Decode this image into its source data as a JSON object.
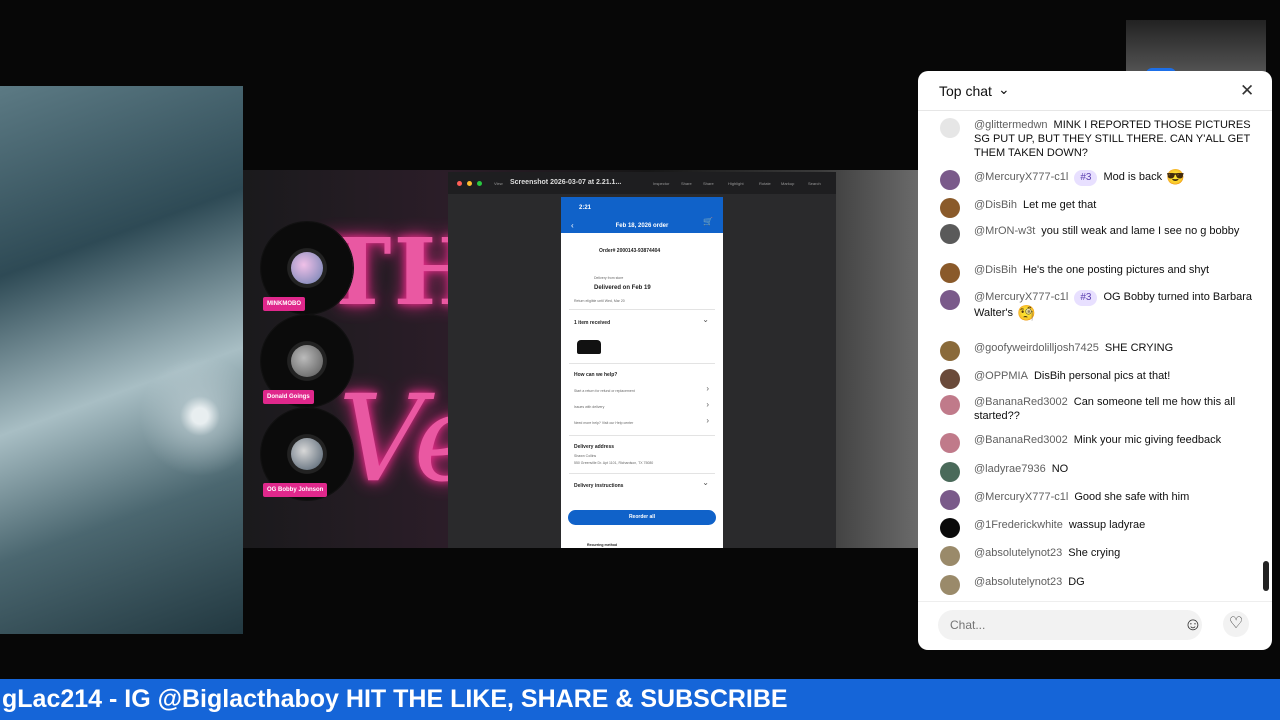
{
  "share": {
    "window_title": "Screenshot 2026-03-07 at 2.21.1...",
    "toolbar": [
      "View",
      "Inspector",
      "Share",
      "Share",
      "Highlight",
      "Rotate",
      "Markup",
      "Search"
    ]
  },
  "discs": [
    {
      "label": "MINKMOBO"
    },
    {
      "label": "Donald Goings"
    },
    {
      "label": "OG Bobby Johnson"
    }
  ],
  "phone": {
    "time": "2:21",
    "date_title": "Feb 18, 2026 order",
    "order_number": "Order# 2000143-93874404",
    "delivery_from": "Delivery from store",
    "delivered": "Delivered on Feb 19",
    "return_note": "Return eligible until Wed, Mar 20",
    "items_received": "1 item received",
    "help_title": "How can we help?",
    "help_items": [
      "Start a return for refund or replacement",
      "Issues with delivery",
      "Need more help? Visit our Help center"
    ],
    "address_title": "Delivery address",
    "address_name": "Shawn Collins",
    "address_line": "550 Greenville Dr. Apt 1101, Richardson, TX 75080",
    "instructions": "Delivery instructions",
    "reorder": "Reorder all",
    "footer": "Recurring method"
  },
  "chat": {
    "mode": "Top chat",
    "input_placeholder": "Chat...",
    "messages": [
      {
        "author": "@glittermedwn",
        "text": "MINK I REPORTED THOSE PICTURES SG PUT UP, BUT THEY STILL THERE. CAN Y'ALL GET THEM TAKEN DOWN?",
        "badge": "",
        "emoji": "",
        "avatar_color": "#e6e6e6"
      },
      {
        "author": "@MercuryX777-c1l",
        "text": "Mod is back",
        "badge": "#3",
        "emoji": "😎",
        "avatar_color": "#7a5a8a"
      },
      {
        "author": "@DisBih",
        "text": "Let me get that",
        "badge": "",
        "emoji": "",
        "avatar_color": "#8a5a2a"
      },
      {
        "author": "@MrON-w3t",
        "text": "you still weak and lame I see no g bobby",
        "badge": "",
        "emoji": "",
        "avatar_color": "#5a5a5a"
      },
      {
        "author": "@DisBih",
        "text": "He's the one posting pictures and shyt",
        "badge": "",
        "emoji": "",
        "avatar_color": "#8a5a2a"
      },
      {
        "author": "@MercuryX777-c1l",
        "text": "OG Bobby turned into Barbara Walter's",
        "badge": "#3",
        "emoji": "🧐",
        "avatar_color": "#7a5a8a"
      },
      {
        "author": "@goofyweirdolilljosh7425",
        "text": "SHE CRYING",
        "badge": "",
        "emoji": "",
        "avatar_color": "#8a6a3a"
      },
      {
        "author": "@OPPMIA",
        "text": "DisBih personal pics at that!",
        "badge": "",
        "emoji": "",
        "avatar_color": "#6a4a3a"
      },
      {
        "author": "@BananaRed3002",
        "text": "Can someone tell me how this all started??",
        "badge": "",
        "emoji": "",
        "avatar_color": "#c07a8a"
      },
      {
        "author": "@BananaRed3002",
        "text": "Mink your mic giving feedback",
        "badge": "",
        "emoji": "",
        "avatar_color": "#c07a8a"
      },
      {
        "author": "@ladyrae7936",
        "text": "NO",
        "badge": "",
        "emoji": "",
        "avatar_color": "#4a6a5a"
      },
      {
        "author": "@MercuryX777-c1l",
        "text": "Good she safe with him",
        "badge": "",
        "emoji": "",
        "avatar_color": "#7a5a8a"
      },
      {
        "author": "@1Frederickwhite",
        "text": "wassup ladyrae",
        "badge": "",
        "emoji": "",
        "avatar_color": "#0a0a0a"
      },
      {
        "author": "@absolutelynot23",
        "text": "She crying",
        "badge": "",
        "emoji": "",
        "avatar_color": "#9a8a6a"
      },
      {
        "author": "@absolutelynot23",
        "text": "DG",
        "badge": "",
        "emoji": "",
        "avatar_color": "#9a8a6a"
      }
    ]
  },
  "ticker": "gLac214 - IG @Biglacthaboy HIT THE LIKE, SHARE & SUBSCRIBE",
  "colors": {
    "ticker": "#1565d8",
    "neon": "#ff5fb0",
    "phone_blue": "#1062c9"
  }
}
